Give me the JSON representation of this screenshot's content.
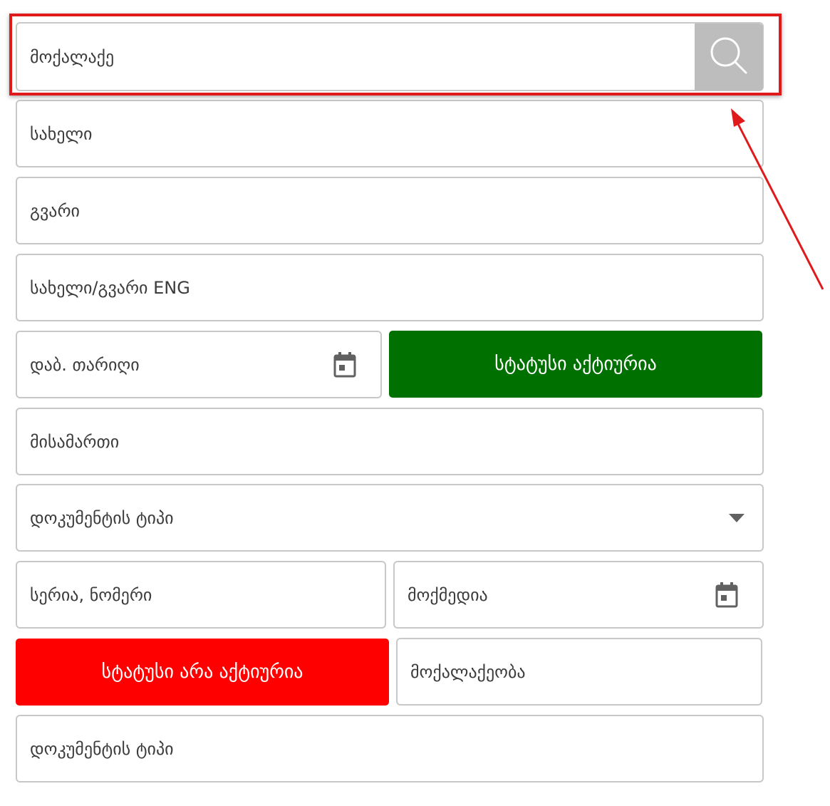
{
  "citizen_search": {
    "placeholder": "მოქალაქე",
    "search_icon": "search-icon"
  },
  "fields": {
    "first_name": "სახელი",
    "last_name": "გვარი",
    "name_eng": "სახელი/გვარი ENG",
    "birth_date": "დაბ. თარიღი",
    "address": "მისამართი",
    "document_type_select": "დოკუმენტის ტიპი",
    "serial_number": "სერია, ნომერი",
    "valid_until": "მოქმედია",
    "citizenship": "მოქალაქეობა",
    "document_type": "დოკუმენტის ტიპი"
  },
  "status": {
    "active_label": "სტატუსი აქტიურია",
    "active_color": "#007000",
    "inactive_label": "სტატუსი არა აქტიურია",
    "inactive_color": "#ff0000"
  },
  "icons": {
    "calendar": "calendar-icon",
    "dropdown": "caret-down-icon"
  },
  "annotation": {
    "highlight_color": "#e0191b"
  }
}
